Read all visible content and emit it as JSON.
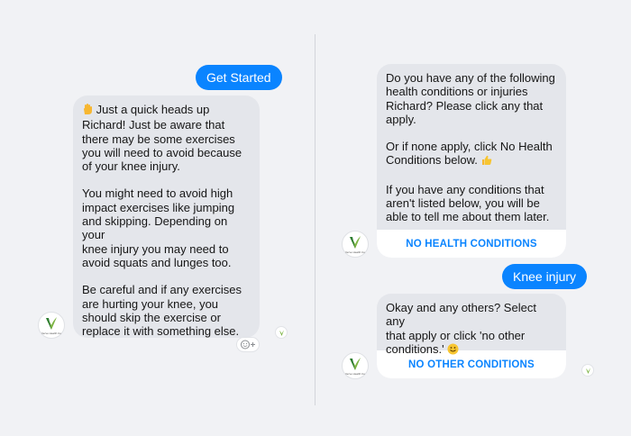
{
  "colors": {
    "background": "#f1f2f5",
    "user_bubble": "#0a84ff",
    "bot_bubble": "#e4e6eb",
    "quick_reply_text": "#0a84ff",
    "logo_green": "#7cb342"
  },
  "left": {
    "user_message": "Get Started",
    "bot_message": {
      "paragraphs": [
        "Just a quick heads up\nRichard! Just be aware that\nthere may be some exercises\nyou will need to avoid because\nof your knee injury.",
        "You might need to avoid high\nimpact exercises like jumping\nand skipping. Depending on your\nknee injury you may need to\navoid squats and lunges too.",
        "Be careful and if any exercises\nare hurting your knee, you\nshould skip the exercise or\nreplace it with something else."
      ]
    }
  },
  "right": {
    "bot_message_1": {
      "paragraphs": [
        "Do you have any of the following\nhealth conditions or injuries\nRichard? Please click any that\napply.",
        "Or if none apply, click No Health\nConditions below.",
        "If you have any conditions that\naren't listed below, you will be\nable to tell me about them later."
      ],
      "quick_reply": "NO HEALTH CONDITIONS"
    },
    "user_message": "Knee injury",
    "bot_message_2": {
      "text": "Okay and any others? Select any\nthat apply or click 'no other\nconditions.'",
      "quick_reply": "NO OTHER CONDITIONS"
    }
  },
  "icons": {
    "wave": "raised-hand-emoji",
    "smile": "smiley-emoji",
    "thumbs": "thumbs-up-emoji",
    "react": "add-reaction-icon",
    "avatar": "logo-avatar",
    "seen": "seen-receipt-icon"
  },
  "avatar_caption": "Verve Health Co"
}
